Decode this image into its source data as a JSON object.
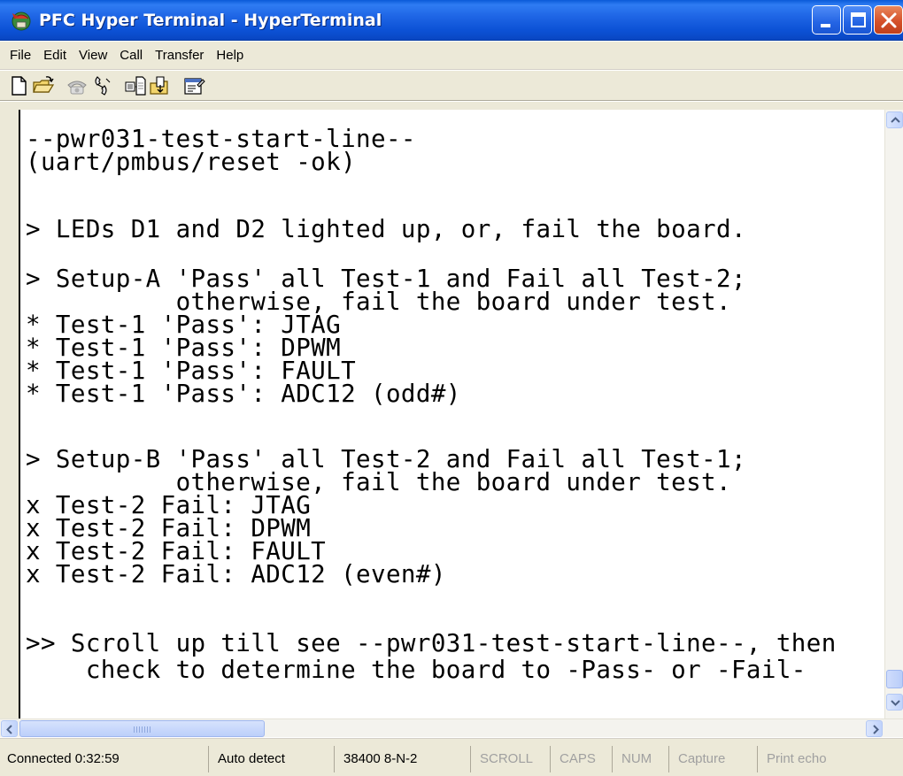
{
  "window": {
    "title": "PFC Hyper Terminal - HyperTerminal"
  },
  "menu": [
    "File",
    "Edit",
    "View",
    "Call",
    "Transfer",
    "Help"
  ],
  "toolbar": {
    "icons": [
      "new-document-icon",
      "open-folder-icon",
      "call-phone-icon",
      "disconnect-phone-icon",
      "send-icon",
      "receive-icon",
      "properties-icon"
    ]
  },
  "terminal": {
    "lines": [
      "--pwr031-test-start-line--",
      "(uart/pmbus/reset -ok)",
      "",
      "> LEDs D1 and D2 lighted up, or, fail the board.",
      "",
      "> Setup-A 'Pass' all Test-1 and Fail all Test-2;",
      "          otherwise, fail the board under test.",
      "* Test-1 'Pass': JTAG",
      "* Test-1 'Pass': DPWM",
      "* Test-1 'Pass': FAULT",
      "* Test-1 'Pass': ADC12 (odd#)",
      "",
      "> Setup-B 'Pass' all Test-2 and Fail all Test-1;",
      "          otherwise, fail the board under test.",
      "x Test-2 Fail: JTAG",
      "x Test-2 Fail: DPWM",
      "x Test-2 Fail: FAULT",
      "x Test-2 Fail: ADC12 (even#)",
      "",
      ">> Scroll up till see --pwr031-test-start-line--, then",
      "    check to determine the board to -Pass- or -Fail-"
    ]
  },
  "status": {
    "connected": "Connected 0:32:59",
    "detect": "Auto detect",
    "port": "38400 8-N-2",
    "scroll": "SCROLL",
    "caps": "CAPS",
    "num": "NUM",
    "capture": "Capture",
    "print_echo": "Print echo"
  },
  "colors": {
    "titlebar": "#0c52d6",
    "chrome": "#ece9d8",
    "terminal_bg": "#ffffff",
    "terminal_text": "#000000"
  }
}
